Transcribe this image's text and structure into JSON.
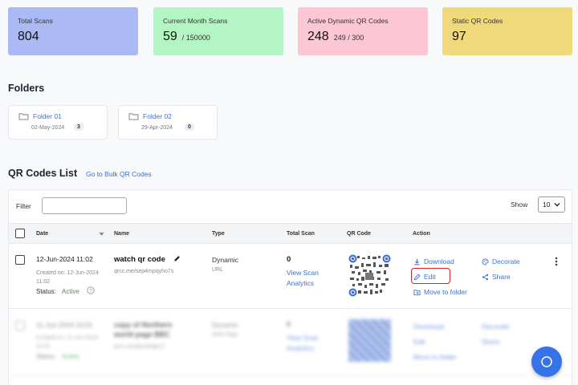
{
  "stats": [
    {
      "label": "Total Scans",
      "value": "804",
      "sub": "",
      "color": "#abb9f5"
    },
    {
      "label": "Current Month Scans",
      "value": "59",
      "sub": "/ 150000",
      "color": "#b4f5c4"
    },
    {
      "label": "Active Dynamic QR Codes",
      "value": "248",
      "sub": "249  / 300",
      "color": "#fcc6d4"
    },
    {
      "label": "Static QR Codes",
      "value": "97",
      "sub": "",
      "color": "#f0d97a"
    }
  ],
  "folders_title": "Folders",
  "folders": [
    {
      "name": "Folder 01",
      "date": "02-May-2024",
      "count": "3"
    },
    {
      "name": "Folder 02",
      "date": "29-Apr-2024",
      "count": "0"
    }
  ],
  "list_title": "QR Codes List",
  "bulk_link": "Go to Bulk QR Codes",
  "filter_label": "Filter",
  "filter_value": "",
  "show_label": "Show",
  "show_value": "10",
  "columns": [
    "Date",
    "Name",
    "Type",
    "Total Scan",
    "QR Code",
    "Action"
  ],
  "row1": {
    "date": "12-Jun-2024 11:02",
    "created_label": "Created on: 12-Jun-2024 11:02",
    "status_label": "Status:",
    "status": "Active",
    "name": "watch qr code",
    "url": "qrcc.me/sep4mpqyho7s",
    "type": "Dynamic",
    "subtype": "URL",
    "scans": "0",
    "view_scan": "View Scan Analytics",
    "download": "Download",
    "decorate": "Decorate",
    "edit": "Edit",
    "share": "Share",
    "move": "Move to folder"
  },
  "row2": {
    "date": "11-Jun-2024 10:01",
    "created_label": "Created on: 11-Jun-2024 10:01",
    "status_label": "Status:",
    "status": "Active",
    "name": "copy of Northern world page BBC",
    "url": "qrcc.me/abcdefgh12",
    "type": "Dynamic",
    "subtype": "Web Page",
    "scans": "0",
    "view_scan": "View Scan Analytics",
    "download": "Download",
    "decorate": "Decorate",
    "edit": "Edit",
    "share": "Share",
    "move": "Move to folder"
  }
}
